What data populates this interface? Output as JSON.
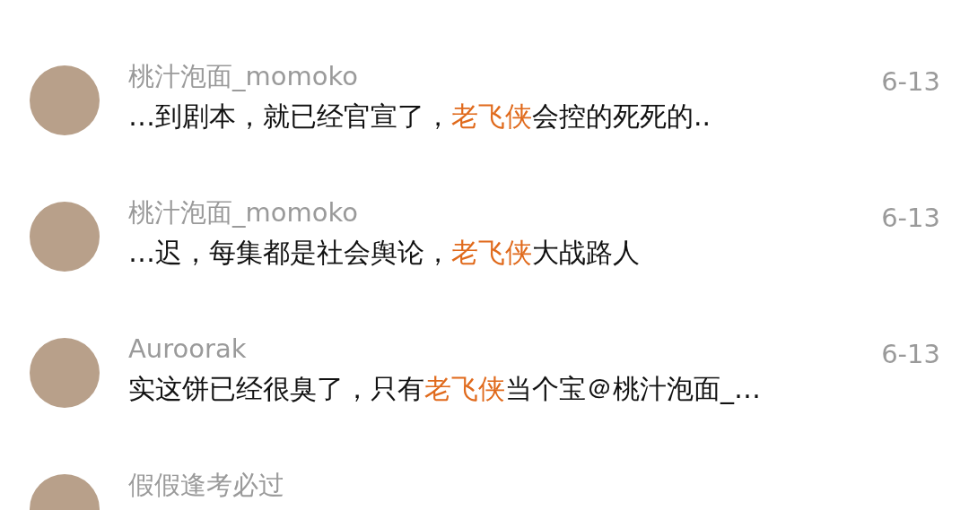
{
  "comments": [
    {
      "author": "桃汁泡面_momoko",
      "date": "6-13",
      "text": [
        {
          "text": "…到剧本，就已经官宣了，",
          "highlight": false
        },
        {
          "text": "老飞侠",
          "highlight": true
        },
        {
          "text": "会控的死死的..",
          "highlight": false
        }
      ]
    },
    {
      "author": "桃汁泡面_momoko",
      "date": "6-13",
      "text": [
        {
          "text": "…迟，每集都是社会舆论，",
          "highlight": false
        },
        {
          "text": "老飞侠",
          "highlight": true
        },
        {
          "text": "大战路人",
          "highlight": false
        }
      ]
    },
    {
      "author": "Auroorak",
      "date": "6-13",
      "text": [
        {
          "text": "实这饼已经很臭了，只有",
          "highlight": false
        },
        {
          "text": "老飞侠",
          "highlight": true
        },
        {
          "text": "当个宝＠桃汁泡面_…",
          "highlight": false
        }
      ]
    },
    {
      "author": "假假逢考必过"
    }
  ]
}
